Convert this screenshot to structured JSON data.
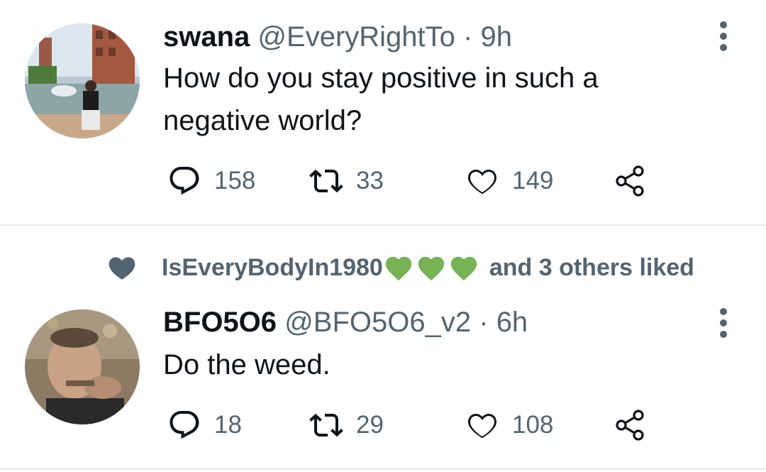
{
  "tweets": [
    {
      "name": "swana",
      "handle": "@EveryRightTo",
      "separator": "·",
      "time": "9h",
      "text_line1": "How do you stay positive in such a",
      "text_line2": "negative world?",
      "replies": "158",
      "retweets": "33",
      "likes": "149"
    },
    {
      "name": "BFO5O6",
      "handle": "@BFO5O6_v2",
      "separator": "·",
      "time": "6h",
      "text_line1": "Do the weed.",
      "replies": "18",
      "retweets": "29",
      "likes": "108"
    }
  ],
  "social_context": {
    "liker": "IsEveryBodyIn1980",
    "suffix": "and 3 others liked",
    "heart_emojis": [
      "green-heart",
      "green-heart",
      "green-heart"
    ]
  },
  "colors": {
    "text": "#0f1419",
    "secondary": "#536471",
    "divider": "#e6e9ec",
    "green_heart": "#77b255"
  },
  "icons": [
    "reply-icon",
    "retweet-icon",
    "like-icon",
    "share-icon",
    "more-icon",
    "liked-heart-icon"
  ]
}
